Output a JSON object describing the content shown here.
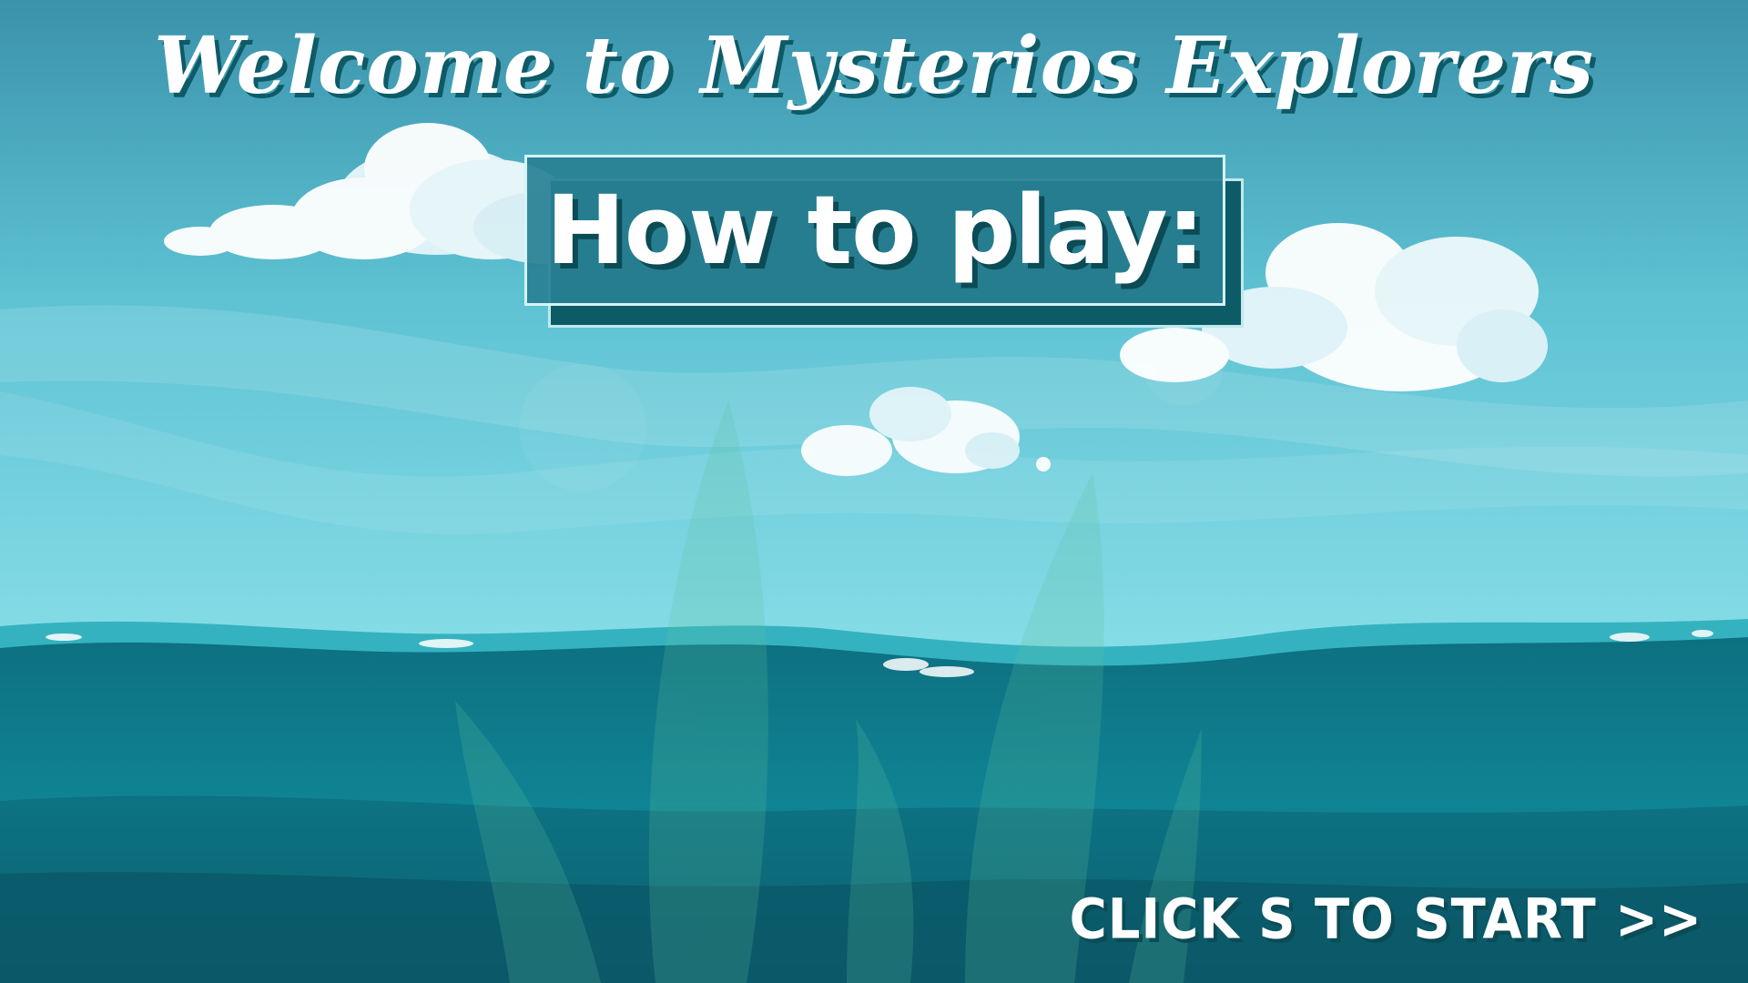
{
  "screen": {
    "title": "Welcome to Mysterios Explorers",
    "heading": "How to play:",
    "start_prompt": "CLICK S TO START >>"
  },
  "colors": {
    "sky_top": "#3a94ad",
    "sky_bottom": "#7fdbe6",
    "sea_surface": "#0f7787",
    "sea_deep": "#0b4f5f",
    "panel": "#288092",
    "text_shadow": "#0b4b55"
  }
}
